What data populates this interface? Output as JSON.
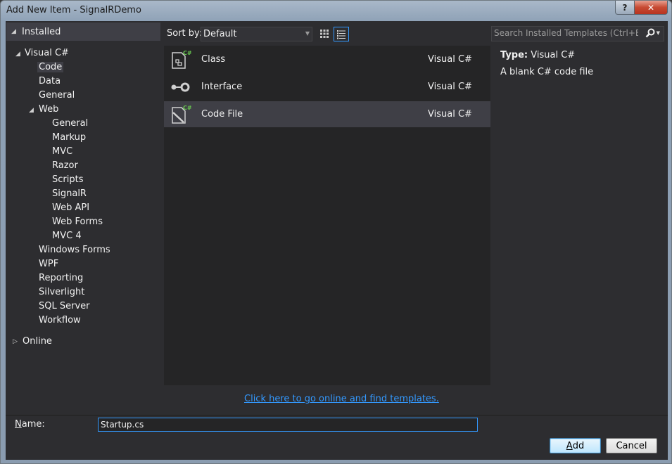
{
  "window": {
    "title": "Add New Item - SignalRDemo",
    "help_glyph": "?",
    "close_glyph": "✕"
  },
  "sidebar": {
    "installed_label": "Installed",
    "tree": [
      {
        "label": "Visual C#"
      },
      {
        "label": "Code",
        "selected": true
      },
      {
        "label": "Data"
      },
      {
        "label": "General"
      },
      {
        "label": "Web"
      },
      {
        "label": "General"
      },
      {
        "label": "Markup"
      },
      {
        "label": "MVC"
      },
      {
        "label": "Razor"
      },
      {
        "label": "Scripts"
      },
      {
        "label": "SignalR"
      },
      {
        "label": "Web API"
      },
      {
        "label": "Web Forms"
      },
      {
        "label": "MVC 4"
      },
      {
        "label": "Windows Forms"
      },
      {
        "label": "WPF"
      },
      {
        "label": "Reporting"
      },
      {
        "label": "Silverlight"
      },
      {
        "label": "SQL Server"
      },
      {
        "label": "Workflow"
      }
    ],
    "online_label": "Online"
  },
  "toolbar": {
    "sort_label": "Sort by:",
    "sort_value": "Default",
    "search_placeholder": "Search Installed Templates (Ctrl+E)"
  },
  "templates": [
    {
      "name": "Class",
      "language": "Visual C#",
      "icon": "class-icon",
      "selected": false
    },
    {
      "name": "Interface",
      "language": "Visual C#",
      "icon": "interface-icon",
      "selected": false
    },
    {
      "name": "Code File",
      "language": "Visual C#",
      "icon": "code-file-icon",
      "selected": true
    }
  ],
  "details": {
    "type_label": "Type:",
    "type_value": "Visual C#",
    "description": "A blank C# code file"
  },
  "online_link": "Click here to go online and find templates.",
  "footer": {
    "name_label_first": "N",
    "name_label_rest": "ame:",
    "name_value": "Startup.cs",
    "add_first": "A",
    "add_rest": "dd",
    "cancel_label": "Cancel"
  },
  "colors": {
    "accent": "#3399ff",
    "background": "#2d2d30",
    "list_background": "#252526",
    "selection": "#3f3f46"
  }
}
